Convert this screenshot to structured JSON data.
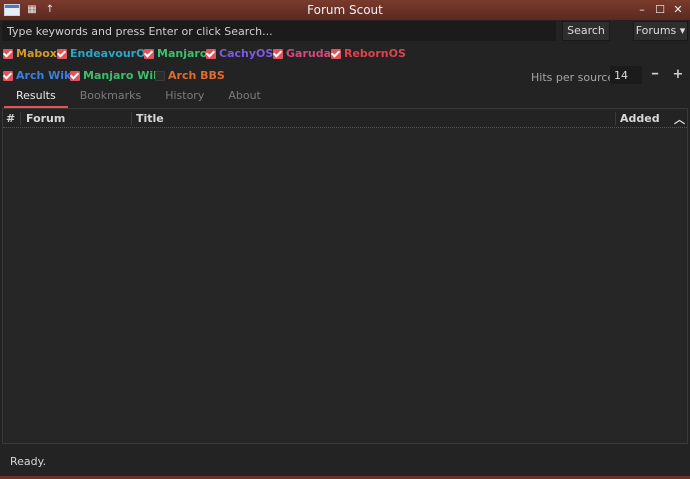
{
  "window": {
    "title": "Forum Scout"
  },
  "search": {
    "placeholder": "Type keywords and press Enter or click Search...",
    "button": "Search",
    "forums_button": "Forums ▾"
  },
  "sources_row1": [
    {
      "label": "Mabox",
      "checked": true,
      "color": "#d69a2c"
    },
    {
      "label": "EndeavourOS",
      "checked": true,
      "color": "#2ba6c8"
    },
    {
      "label": "Manjaro",
      "checked": true,
      "color": "#3cbf6a"
    },
    {
      "label": "CachyOS",
      "checked": true,
      "color": "#7a5ae0"
    },
    {
      "label": "Garuda",
      "checked": true,
      "color": "#d8477c"
    },
    {
      "label": "RebornOS",
      "checked": true,
      "color": "#e0434a"
    }
  ],
  "sources_row2": [
    {
      "label": "Arch Wiki",
      "checked": true,
      "color": "#3a7fe0"
    },
    {
      "label": "Manjaro Wiki",
      "checked": true,
      "color": "#3cbf6a"
    },
    {
      "label": "Arch BBS",
      "checked": false,
      "color": "#e06b2c"
    }
  ],
  "hits": {
    "label": "Hits per source:",
    "value": "14"
  },
  "tabs": [
    {
      "label": "Results",
      "active": true
    },
    {
      "label": "Bookmarks",
      "active": false
    },
    {
      "label": "History",
      "active": false
    },
    {
      "label": "About",
      "active": false
    }
  ],
  "table": {
    "columns": [
      "#",
      "Forum",
      "Title",
      "Added"
    ]
  },
  "status": {
    "text": "Ready."
  },
  "icons": {
    "app": "window-icon",
    "titlebar_left": [
      "grid-icon",
      "up-arrow-icon"
    ],
    "titlebar_right": [
      "minimize-icon",
      "maximize-icon",
      "close-icon"
    ]
  }
}
